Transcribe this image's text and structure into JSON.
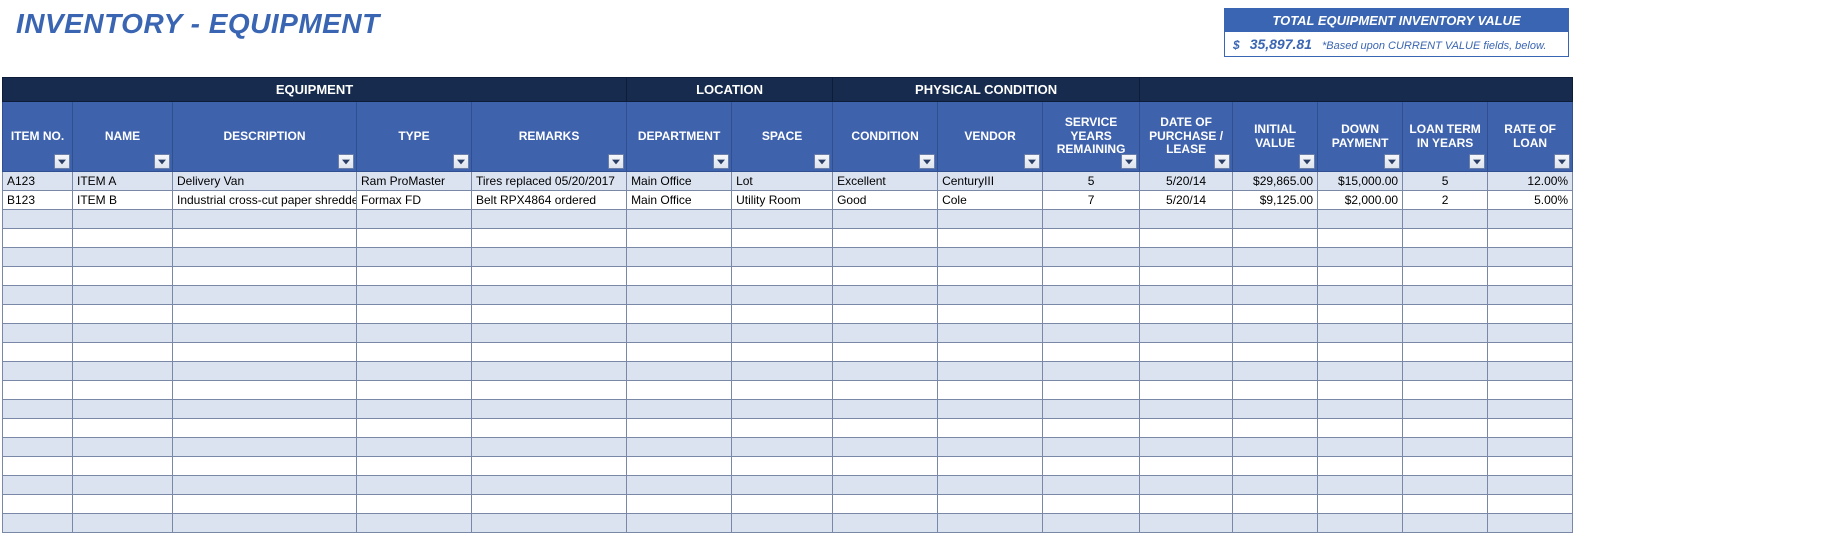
{
  "title": "INVENTORY - EQUIPMENT",
  "total_box": {
    "heading": "TOTAL EQUIPMENT INVENTORY VALUE",
    "currency": "$",
    "value": "35,897.81",
    "note": "*Based upon CURRENT VALUE fields, below."
  },
  "groups": {
    "equipment": "EQUIPMENT",
    "location": "LOCATION",
    "physical": "PHYSICAL CONDITION",
    "blank": ""
  },
  "columns": {
    "item_no": "ITEM NO.",
    "name": "NAME",
    "description": "DESCRIPTION",
    "type": "TYPE",
    "remarks": "REMARKS",
    "department": "DEPARTMENT",
    "space": "SPACE",
    "condition": "CONDITION",
    "vendor": "VENDOR",
    "svc_years": "SERVICE YEARS REMAINING",
    "date_purchase": "DATE OF PURCHASE / LEASE",
    "initial_value": "INITIAL VALUE",
    "down_payment": "DOWN PAYMENT",
    "loan_term": "LOAN TERM IN YEARS",
    "rate_loan": "RATE OF LOAN"
  },
  "rows": [
    {
      "item_no": "A123",
      "name": "ITEM A",
      "description": "Delivery Van",
      "type": "Ram ProMaster",
      "remarks": "Tires replaced 05/20/2017",
      "department": "Main Office",
      "space": "Lot",
      "condition": "Excellent",
      "vendor": "CenturyIII",
      "svc_years": "5",
      "date_purchase": "5/20/14",
      "initial_value": "$29,865.00",
      "down_payment": "$15,000.00",
      "loan_term": "5",
      "rate_loan": "12.00%"
    },
    {
      "item_no": "B123",
      "name": "ITEM B",
      "description": "Industrial cross-cut paper shredder",
      "type": "Formax FD",
      "remarks": "Belt RPX4864 ordered",
      "department": "Main Office",
      "space": "Utility Room",
      "condition": "Good",
      "vendor": "Cole",
      "svc_years": "7",
      "date_purchase": "5/20/14",
      "initial_value": "$9,125.00",
      "down_payment": "$2,000.00",
      "loan_term": "2",
      "rate_loan": "5.00%"
    }
  ],
  "empty_rows": 17
}
